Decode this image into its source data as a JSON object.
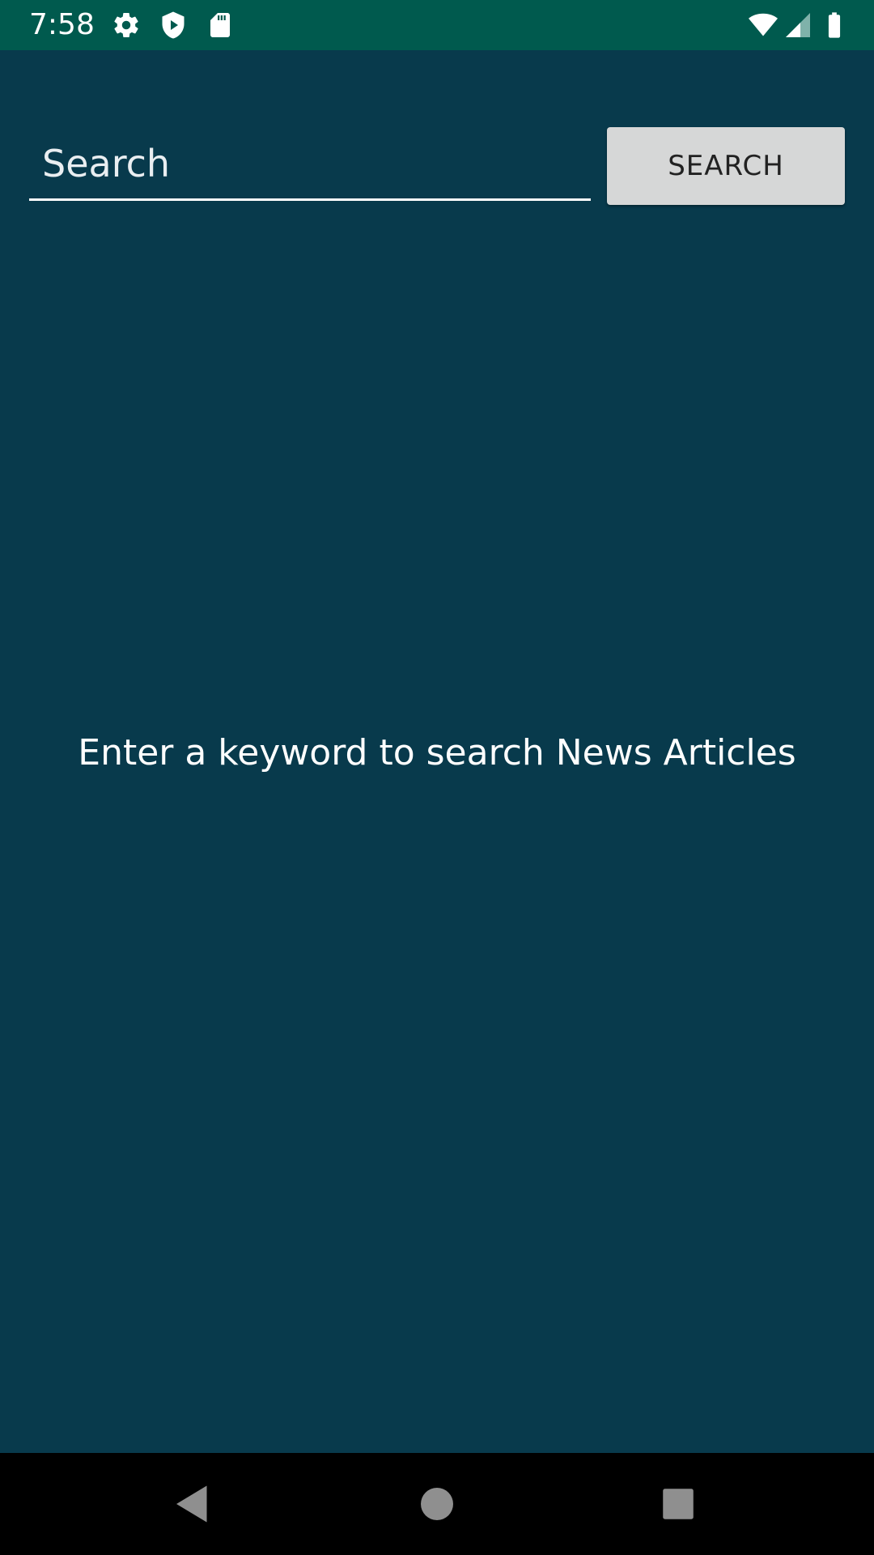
{
  "status_bar": {
    "time": "7:58",
    "icons_left": [
      "gear-icon",
      "play-protect-icon",
      "sd-card-icon"
    ],
    "icons_right": [
      "wifi-icon",
      "signal-icon",
      "battery-icon"
    ],
    "background_color": "#005a4e"
  },
  "search": {
    "placeholder": "Search",
    "value": "",
    "button_label": "SEARCH"
  },
  "content": {
    "empty_message": "Enter a keyword to search News Articles",
    "background_color": "#083a4c"
  },
  "nav_bar": {
    "buttons": [
      "back-icon",
      "home-icon",
      "recents-icon"
    ]
  }
}
